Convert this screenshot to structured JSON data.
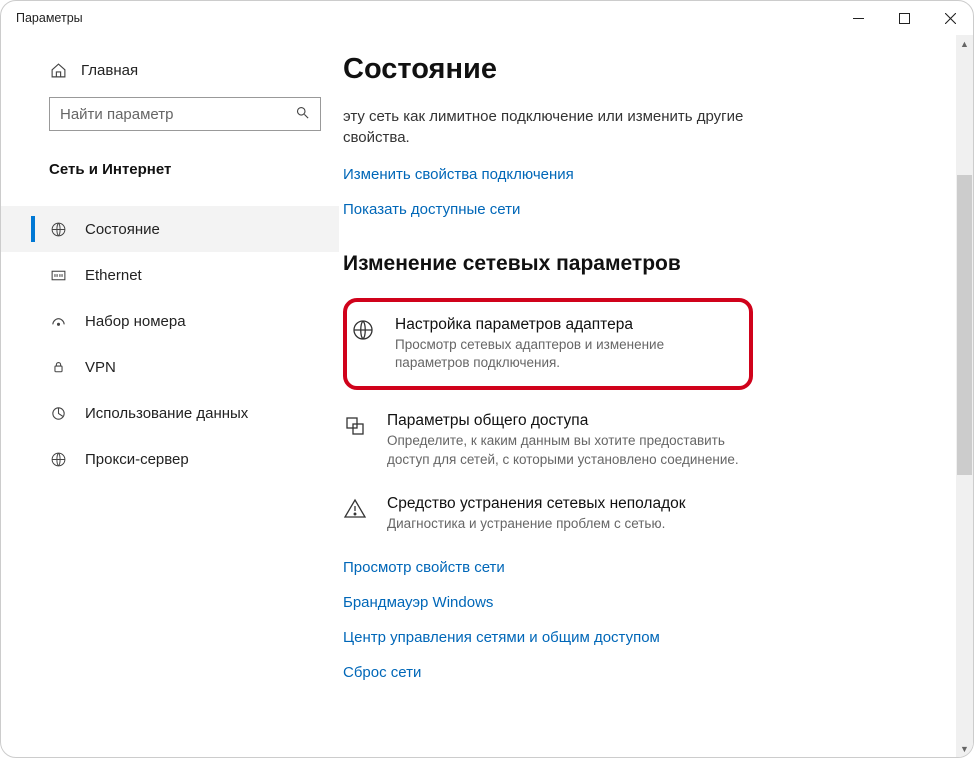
{
  "window": {
    "title": "Параметры"
  },
  "sidebar": {
    "home": "Главная",
    "search_placeholder": "Найти параметр",
    "section": "Сеть и Интернет",
    "items": [
      {
        "label": "Состояние",
        "icon": "globe-icon",
        "active": true
      },
      {
        "label": "Ethernet",
        "icon": "ethernet-icon"
      },
      {
        "label": "Набор номера",
        "icon": "dialup-icon"
      },
      {
        "label": "VPN",
        "icon": "vpn-icon"
      },
      {
        "label": "Использование данных",
        "icon": "data-usage-icon"
      },
      {
        "label": "Прокси-сервер",
        "icon": "proxy-icon"
      }
    ]
  },
  "main": {
    "title": "Состояние",
    "intro_fragment": "эту сеть как лимитное подключение или изменить другие свойства.",
    "link_change_props": "Изменить свойства подключения",
    "link_show_networks": "Показать доступные сети",
    "section2_heading": "Изменение сетевых параметров",
    "actions": [
      {
        "title": "Настройка параметров адаптера",
        "desc": "Просмотр сетевых адаптеров и изменение параметров подключения.",
        "highlighted": true
      },
      {
        "title": "Параметры общего доступа",
        "desc": "Определите, к каким данным вы хотите предоставить доступ для сетей, с которыми установлено соединение."
      },
      {
        "title": "Средство устранения сетевых неполадок",
        "desc": "Диагностика и устранение проблем с сетью."
      }
    ],
    "links_after": [
      "Просмотр свойств сети",
      "Брандмауэр Windows",
      "Центр управления сетями и общим доступом",
      "Сброс сети"
    ]
  }
}
